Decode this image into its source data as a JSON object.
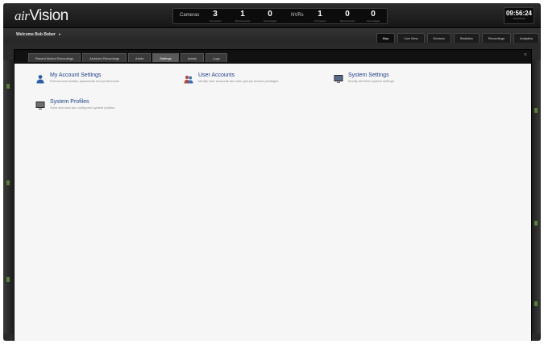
{
  "app": {
    "logo_prefix": "air",
    "logo_main": "Vision"
  },
  "stats": {
    "cameras_label": "Cameras",
    "cameras": [
      {
        "value": "3",
        "sub": "Connected"
      },
      {
        "value": "1",
        "sub": "Disconnected"
      },
      {
        "value": "0",
        "sub": "Unmanaged"
      }
    ],
    "nvrs_label": "NVRs",
    "nvrs": [
      {
        "value": "1",
        "sub": "Connected"
      },
      {
        "value": "0",
        "sub": "Disconnected"
      },
      {
        "value": "0",
        "sub": "Unmanaged"
      }
    ]
  },
  "clock": {
    "time": "09:56:24",
    "date": "2013/06/11"
  },
  "user": {
    "welcome": "Welcome Bob Bober",
    "caret": "▾"
  },
  "nav_tabs": [
    "Map",
    "Live View",
    "Devices",
    "Statistics",
    "Recordings",
    "Analytics"
  ],
  "nav_active": "Map",
  "panel_tabs": [
    "Recent Motion Recordings",
    "Archived Recordings",
    "Alerts",
    "Settings",
    "Admin",
    "Logs"
  ],
  "panel_active": "Settings",
  "panel_close": "×",
  "settings": {
    "my_account": {
      "title": "My Account Settings",
      "desc": "Edit account details, passwords and preferences"
    },
    "user_accounts": {
      "title": "User Accounts",
      "desc": "Modify user accounts and user groups access privileges"
    },
    "system_settings": {
      "title": "System Settings",
      "desc": "Modify airVision system settings"
    },
    "system_profiles": {
      "title": "System Profiles",
      "desc": "Save and load pre-configured system profiles"
    }
  },
  "colors": {
    "link": "#1e3d8a",
    "header_bg": "#1a1a1a",
    "panel_bg": "#f6f6f6"
  }
}
